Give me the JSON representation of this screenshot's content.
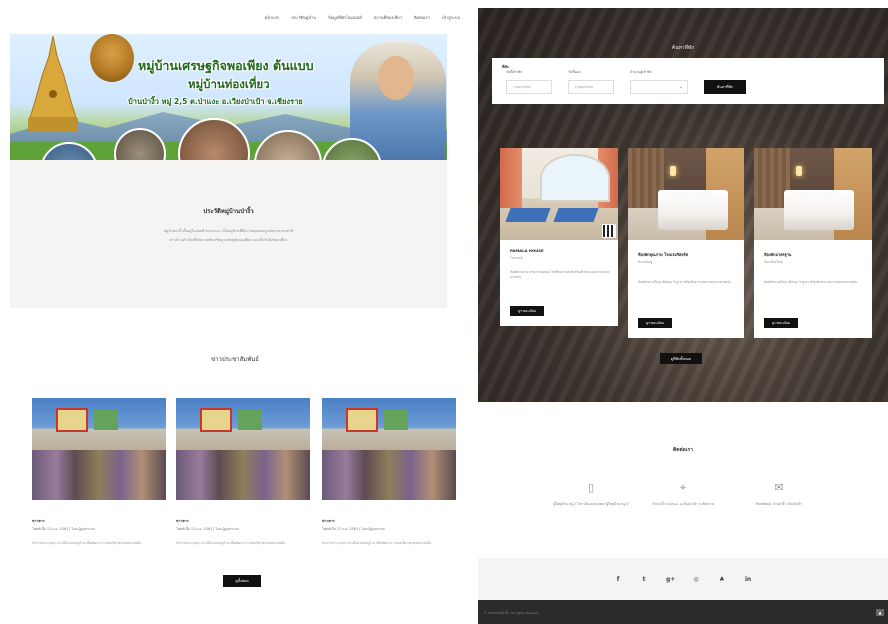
{
  "left_page": {
    "nav": {
      "items": [
        "หน้าแรก",
        "ประวัติหมู่บ้าน",
        "ข้อมูลที่พักโฮมสเตย์",
        "สถานที่ท่องเที่ยว",
        "ติดต่อเรา",
        "เข้าสู่ระบบ"
      ]
    },
    "banner": {
      "title_line1": "หมู่บ้านเศรษฐกิจพอเพียง ต้นแบบ",
      "title_line2": "หมู่บ้านท่องเที่ยว",
      "title_line3": "บ้านป่างิ้ว หมู่ 2,5 ต.ป่าแงะ อ.เวียงป่าเป้า จ.เชียงราย"
    },
    "history": {
      "title": "ประวัติหมู่บ้านป่างิ้ว",
      "text_line1": "หมู่บ้านป่างิ้วตั้งอยู่ในเขตตำบลป่าแงะ เป็นหมู่บ้านที่มีความอุดมสมบูรณ์ทางธรรมชาติ",
      "text_line2": "ชาวบ้านดำเนินชีวิตตามหลักปรัชญาเศรษฐกิจพอเพียง และเปิดรับนักท่องเที่ยว"
    },
    "news": {
      "title": "ข่าวประชาสัมพันธ์",
      "cards": [
        {
          "category": "ข่าวสาร",
          "meta": "โพสต์เมื่อ 12 ก.ย. 2561 | โดย ผู้ดูแลระบบ",
          "excerpt": "กิจกรรมประชุมประจำเดือนของหมู่บ้าน เพื่อพัฒนาการท่องเที่ยวชุมชนอย่างยั่งยืน"
        },
        {
          "category": "ข่าวสาร",
          "meta": "โพสต์เมื่อ 12 ก.ย. 2561 | โดย ผู้ดูแลระบบ",
          "excerpt": "กิจกรรมประชุมประจำเดือนของหมู่บ้าน เพื่อพัฒนาการท่องเที่ยวชุมชนอย่างยั่งยืน"
        },
        {
          "category": "ข่าวสาร",
          "meta": "โพสต์เมื่อ 12 ก.ย. 2561 | โดย ผู้ดูแลระบบ",
          "excerpt": "กิจกรรมประชุมประจำเดือนของหมู่บ้าน เพื่อพัฒนาการท่องเที่ยวชุมชนอย่างยั่งยืน"
        }
      ],
      "more_label": "ดูทั้งหมด"
    }
  },
  "right_page": {
    "search": {
      "heading": "ค้นหาที่พัก",
      "type_label": "ที่พัก",
      "fields": [
        {
          "label": "วันที่เข้าพัก",
          "placeholder": "วว/ดด/ปปปป"
        },
        {
          "label": "วันที่ออก",
          "placeholder": "วว/ดด/ปปปป"
        },
        {
          "label": "จำนวนผู้เข้าพัก",
          "placeholder": ""
        }
      ],
      "button_label": "ค้นหาที่พัก"
    },
    "rooms": [
      {
        "name": "PAMALA HOUSE",
        "sub": "โฮมสเตย์",
        "desc": "ห้องพักสะอาด บรรยากาศอบอุ่น ใกล้ชิดธรรมชาติ พร้อมสิ่งอำนวยความสะดวกครบครัน",
        "button_label": "ดูรายละเอียด"
      },
      {
        "name": "ห้องพักคุณภาพ โรงแรมรีสอร์ท",
        "sub": "ห้องเตียงคู่",
        "desc": "ห้องพักขนาดใหญ่ เตียงนุ่ม วิวภูเขา พร้อมสิ่งอำนวยความสะดวกครบครัน",
        "button_label": "ดูรายละเอียด"
      },
      {
        "name": "ห้องพักมาตรฐาน",
        "sub": "ห้องเตียงใหญ่",
        "desc": "ห้องพักขนาดใหญ่ เตียงนุ่ม วิวภูเขา พร้อมสิ่งอำนวยความสะดวกครบครัน",
        "button_label": "ดูรายละเอียด"
      }
    ],
    "more_rooms_label": "ดูที่พักทั้งหมด",
    "contact": {
      "title": "ติดต่อเรา",
      "items": [
        {
          "icon": "phone-icon",
          "glyph": "▯",
          "text": "ผู้ใหญ่บ้าน หมู่ 2 โทร 08x-xxx-xxxx ผู้ใหญ่บ้าน หมู่ 5"
        },
        {
          "icon": "location-icon",
          "glyph": "⌖",
          "text": "บ้านป่างิ้ว ต.ป่าแงะ อ.เวียงป่าเป้า จ.เชียงราย"
        },
        {
          "icon": "mail-icon",
          "glyph": "✉",
          "text": "Facebook: บ้านป่างิ้ว เวียงป่าเป้า"
        }
      ]
    },
    "social": [
      "f",
      "t",
      "g+",
      "◎",
      "♣",
      "in"
    ],
    "footer": {
      "copyright": "© 2018 บ้านป่างิ้ว. All rights reserved.",
      "totop": "▲"
    }
  }
}
